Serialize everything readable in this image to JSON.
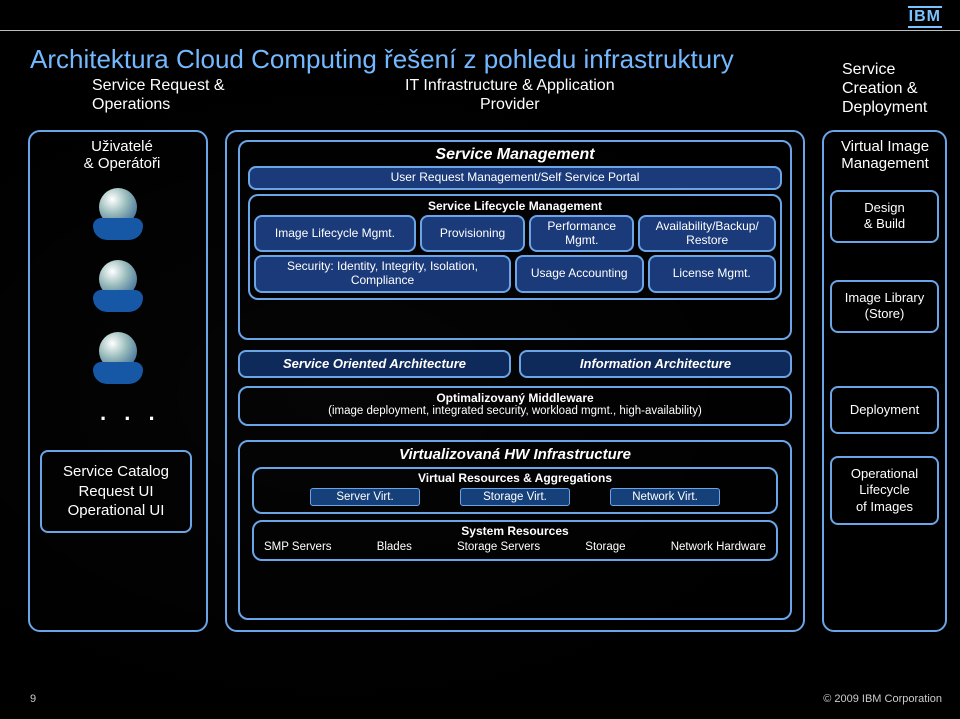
{
  "logo": "IBM",
  "title": "Architektura Cloud Computing řešení z pohledu infrastruktury",
  "columns": {
    "left": {
      "l1": "Service Request &",
      "l2": "Operations"
    },
    "mid": {
      "l1": "IT Infrastructure & Application",
      "l2": "Provider"
    },
    "right": {
      "l1": "Service",
      "l2": "Creation &",
      "l3": "Deployment"
    }
  },
  "left": {
    "users": {
      "l1": "Uživatelé",
      "l2": "& Operátoři"
    },
    "catalog": {
      "l1": "Service Catalog",
      "l2": "Request UI",
      "l3": "Operational UI"
    }
  },
  "mid": {
    "sm": {
      "title": "Service Management",
      "userRequest": "User Request Management/Self Service Portal",
      "slmTitle": "Service Lifecycle Management",
      "row1": {
        "a": "Image Lifecycle Mgmt.",
        "b": "Provisioning",
        "c": "Performance Mgmt.",
        "d": "Availability/Backup/ Restore"
      },
      "row2": {
        "a": "Security: Identity, Integrity, Isolation, Compliance",
        "b": "Usage Accounting",
        "c": "License Mgmt."
      }
    },
    "arch": {
      "soa": "Service Oriented Architecture",
      "info": "Information Architecture"
    },
    "mw": {
      "l1": "Optimalizovaný Middleware",
      "l2": "(image deployment, integrated security, workload mgmt., high-availability)"
    },
    "hw": {
      "title": "Virtualizovaná HW Infrastructure",
      "vr": {
        "title": "Virtual Resources & Aggregations",
        "a": "Server Virt.",
        "b": "Storage Virt.",
        "c": "Network Virt."
      },
      "sr": {
        "title": "System Resources",
        "a": "SMP Servers",
        "b": "Blades",
        "c": "Storage Servers",
        "d": "Storage",
        "e": "Network Hardware"
      }
    }
  },
  "right": {
    "vim": {
      "l1": "Virtual Image",
      "l2": "Management"
    },
    "b1": {
      "l1": "Design",
      "l2": "& Build"
    },
    "b2": {
      "l1": "Image Library",
      "l2": "(Store)"
    },
    "b3": {
      "l1": "Deployment"
    },
    "b4": {
      "l1": "Operational",
      "l2": "Lifecycle",
      "l3": "of Images"
    }
  },
  "footer": {
    "num": "9",
    "copy": "© 2009 IBM Corporation"
  }
}
